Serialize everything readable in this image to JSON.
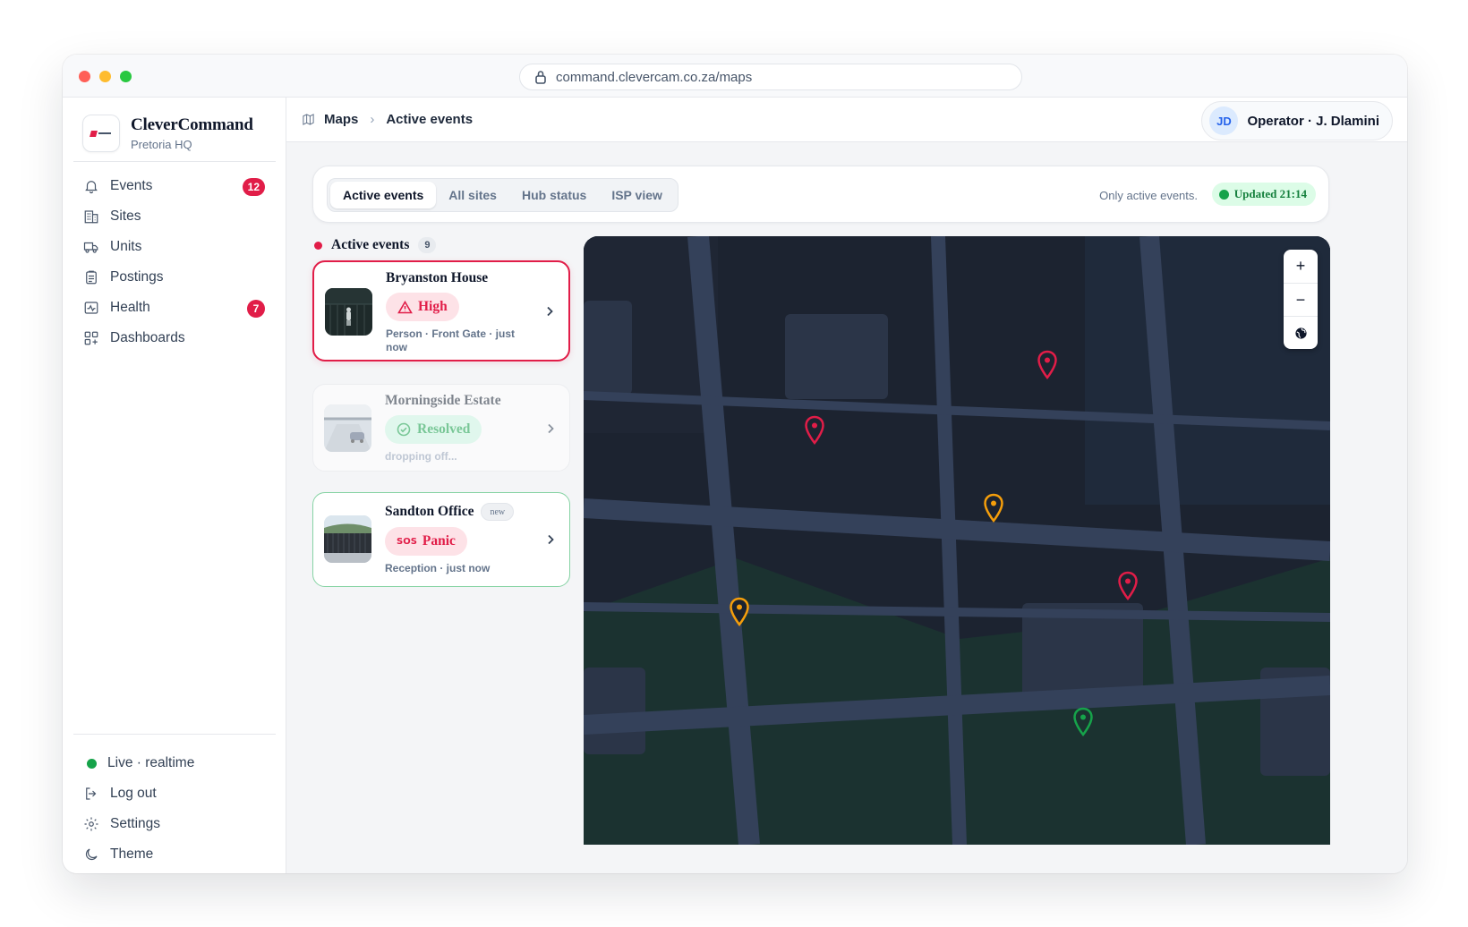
{
  "browser": {
    "url": "command.clevercam.co.za/maps"
  },
  "brand": {
    "name": "CleverCommand",
    "subtitle": "Pretoria HQ"
  },
  "nav": {
    "items": [
      {
        "label": "Events",
        "icon": "bell-icon",
        "count": "12"
      },
      {
        "label": "Sites",
        "icon": "building-icon"
      },
      {
        "label": "Units",
        "icon": "truck-icon"
      },
      {
        "label": "Postings",
        "icon": "clipboard-icon"
      },
      {
        "label": "Health",
        "icon": "activity-icon",
        "count": "7"
      },
      {
        "label": "Dashboards",
        "icon": "grid-icon"
      }
    ]
  },
  "footer": {
    "status": "Live · realtime",
    "logout": "Log out",
    "settings": "Settings",
    "theme": "Theme"
  },
  "breadcrumb": {
    "root": "Maps",
    "current": "Active events"
  },
  "user": {
    "initials": "JD",
    "name": "Operator · J. Dlamini"
  },
  "filter": {
    "tabs": [
      "Active events",
      "All sites",
      "Hub status",
      "ISP view"
    ],
    "active_tab": "Active events",
    "note": "Only active events.",
    "updated": "Updated 21:14"
  },
  "events": {
    "title": "Active events",
    "count": "9",
    "cards": [
      {
        "site": "Bryanston House",
        "status": "High",
        "meta": "Person · Front Gate · just now",
        "state": "high"
      },
      {
        "site": "Morningside Estate",
        "status": "Resolved",
        "meta": "dropping off...",
        "state": "resolved"
      },
      {
        "site": "Sandton Office",
        "tag": "new",
        "status": "Panic",
        "status_icon_text": "SOS",
        "meta": "Reception · just now",
        "state": "panic"
      }
    ]
  },
  "map": {
    "controls": {
      "zoom_in": "+",
      "zoom_out": "−"
    },
    "pins": [
      {
        "severity": "critical",
        "color": "#e11d48"
      },
      {
        "severity": "critical",
        "color": "#e11d48"
      },
      {
        "severity": "warning",
        "color": "#f59e0b"
      },
      {
        "severity": "critical",
        "color": "#e11d48"
      },
      {
        "severity": "warning",
        "color": "#f59e0b"
      },
      {
        "severity": "ok",
        "color": "#16a34a"
      }
    ]
  },
  "colors": {
    "accent_red": "#e11d48",
    "success_green": "#16a34a",
    "warning_amber": "#f59e0b"
  }
}
